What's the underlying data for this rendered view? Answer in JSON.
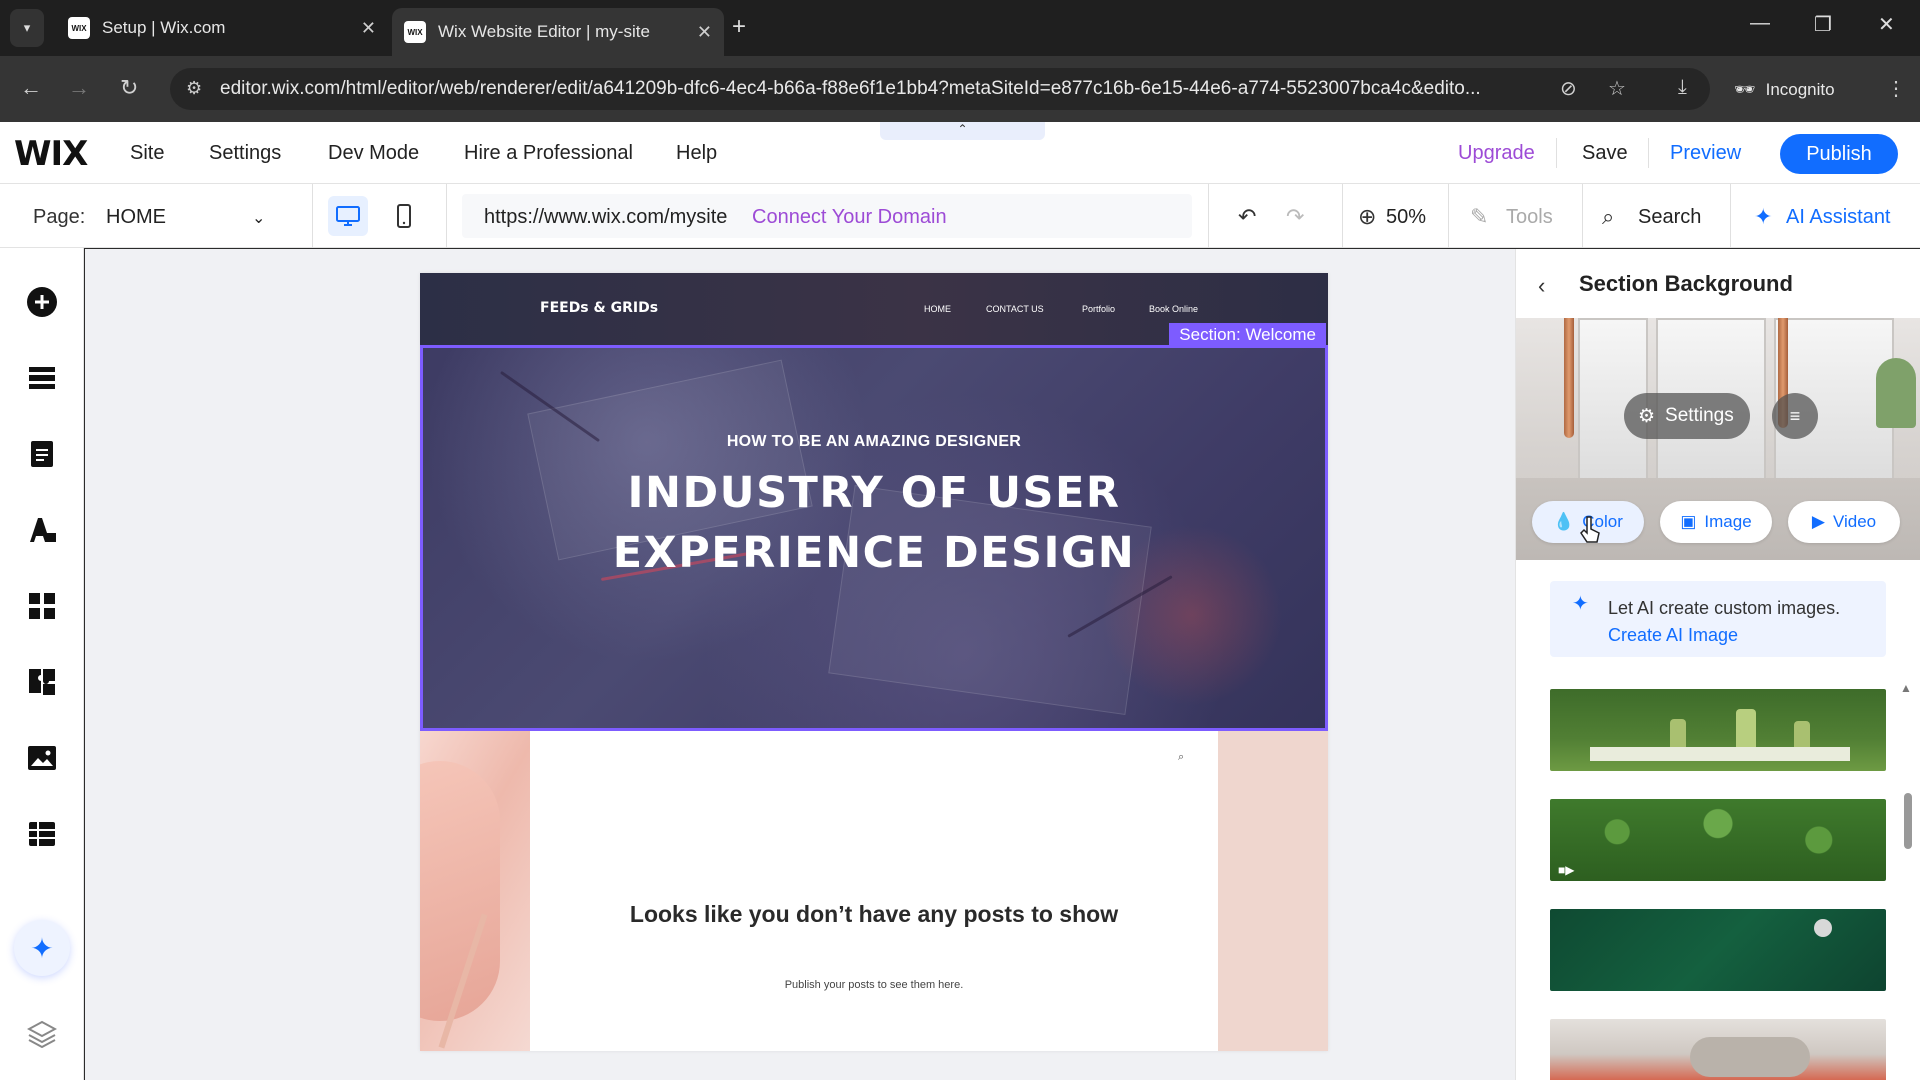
{
  "browser": {
    "tabs": [
      {
        "title": "Setup | Wix.com",
        "favicon": "WIX"
      },
      {
        "title": "Wix Website Editor | my-site",
        "favicon": "WIX"
      }
    ],
    "url": "editor.wix.com/html/editor/web/renderer/edit/a641209b-dfc6-4ec4-b66a-f88e6f1e1bb4?metaSiteId=e877c16b-6e15-44e6-a774-5523007bca4c&edito...",
    "incognito_label": "Incognito"
  },
  "wix_topbar": {
    "logo": "WIX",
    "menu": [
      "Site",
      "Settings",
      "Dev Mode",
      "Hire a Professional",
      "Help"
    ],
    "upgrade": "Upgrade",
    "save": "Save",
    "preview": "Preview",
    "publish": "Publish"
  },
  "wix_secbar": {
    "page_label": "Page:",
    "page_value": "HOME",
    "site_url": "https://www.wix.com/mysite",
    "connect_domain": "Connect Your Domain",
    "zoom": "50%",
    "tools": "Tools",
    "search": "Search",
    "ai_assistant": "AI Assistant"
  },
  "left_toolbar": {
    "items": [
      "add-elements",
      "sections",
      "pages",
      "design",
      "apps",
      "business-apps",
      "media",
      "cms"
    ]
  },
  "site": {
    "logo": "FEEDs & GRIDs",
    "nav": [
      "HOME",
      "CONTACT US",
      "Portfolio",
      "Book Online"
    ],
    "section_label": "Section: Welcome",
    "hero_kicker": "HOW TO BE AN AMAZING DESIGNER",
    "hero_title_line1": "INDUSTRY OF USER",
    "hero_title_line2": "EXPERIENCE DESIGN",
    "blog_empty_title": "Looks like you don’t have any posts to show",
    "blog_empty_sub": "Publish your posts to see them here."
  },
  "panel": {
    "title": "Section Background",
    "settings": "Settings",
    "bg_buttons": [
      {
        "label": "Color",
        "icon": "drop-icon"
      },
      {
        "label": "Image",
        "icon": "image-icon"
      },
      {
        "label": "Video",
        "icon": "video-icon"
      }
    ],
    "ai_text": "Let AI create custom images.",
    "ai_link": "Create AI Image"
  },
  "colors": {
    "accent": "#116dff",
    "upgrade": "#9d4bd6",
    "section_outline": "#7d5cff"
  }
}
